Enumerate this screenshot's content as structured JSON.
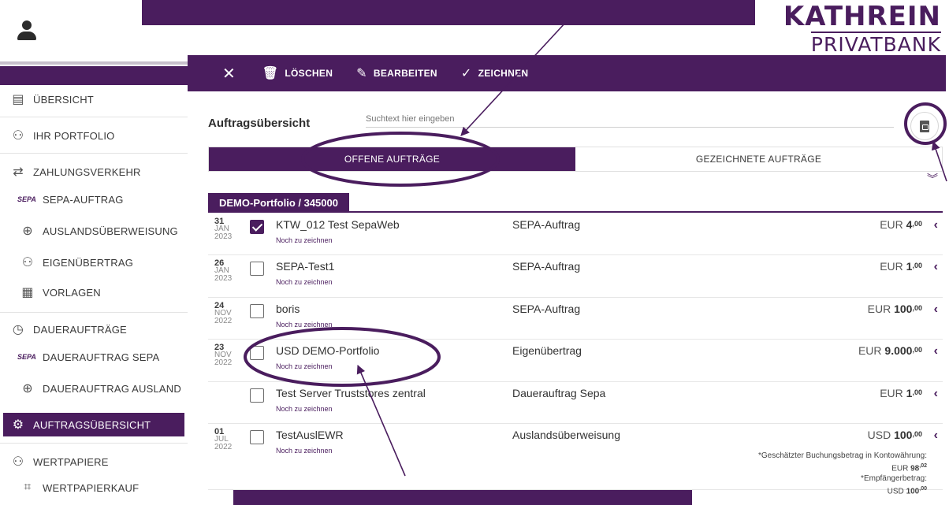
{
  "logo": {
    "line1": "KATHREIN",
    "line2": "PRIVATBANK"
  },
  "sidebar": {
    "items": [
      {
        "label": "ÜBERSICHT",
        "icon": "overview-icon"
      },
      {
        "label": "IHR PORTFOLIO",
        "icon": "portfolio-icon"
      },
      {
        "label": "ZAHLUNGSVERKEHR",
        "icon": "payments-icon"
      },
      {
        "label": "SEPA-AUFTRAG",
        "icon": "sepa-icon",
        "tag": "SEPA"
      },
      {
        "label": "AUSLANDSÜBERWEISUNG",
        "icon": "globe-money-icon"
      },
      {
        "label": "EIGENÜBERTRAG",
        "icon": "own-transfer-icon"
      },
      {
        "label": "VORLAGEN",
        "icon": "templates-icon"
      },
      {
        "label": "DAUERAUFTRÄGE",
        "icon": "standing-order-icon"
      },
      {
        "label": "DAUERAUFTRAG SEPA",
        "icon": "sepa-icon",
        "tag": "SEPA"
      },
      {
        "label": "DAUERAUFTRAG AUSLAND",
        "icon": "globe-money-icon"
      },
      {
        "label": "AUFTRAGSÜBERSICHT",
        "icon": "order-overview-icon",
        "active": true
      },
      {
        "label": "WERTPAPIERE",
        "icon": "securities-icon"
      },
      {
        "label": "WERTPAPIERKAUF",
        "icon": "crop-icon"
      }
    ]
  },
  "toolbar": {
    "close": "✕",
    "delete_label": "LÖSCHEN",
    "edit_label": "BEARBEITEN",
    "sign_label": "ZEICHNEN"
  },
  "main": {
    "title": "Auftragsübersicht",
    "search_placeholder": "Suchtext hier eingeben",
    "tabs": [
      {
        "label": "OFFENE AUFTRÄGE",
        "active": true
      },
      {
        "label": "GEZEICHNETE AUFTRÄGE",
        "active": false
      }
    ],
    "portfolio": "DEMO-Portfolio / 345000",
    "orders": [
      {
        "day": "31",
        "month": "JAN",
        "year": "2023",
        "checked": true,
        "name": "KTW_012 Test SepaWeb",
        "status": "Noch zu zeichnen",
        "type": "SEPA-Auftrag",
        "currency": "EUR",
        "amount": "4",
        "decimals": "00"
      },
      {
        "day": "26",
        "month": "JAN",
        "year": "2023",
        "checked": false,
        "name": "SEPA-Test1",
        "status": "Noch zu zeichnen",
        "type": "SEPA-Auftrag",
        "currency": "EUR",
        "amount": "1",
        "decimals": "00"
      },
      {
        "day": "24",
        "month": "NOV",
        "year": "2022",
        "checked": false,
        "name": "boris",
        "status": "Noch zu zeichnen",
        "type": "SEPA-Auftrag",
        "currency": "EUR",
        "amount": "100",
        "decimals": "00"
      },
      {
        "day": "23",
        "month": "NOV",
        "year": "2022",
        "checked": false,
        "name": "USD DEMO-Portfolio",
        "status": "Noch zu zeichnen",
        "type": "Eigenübertrag",
        "currency": "EUR",
        "amount": "9.000",
        "decimals": "00"
      },
      {
        "day": "",
        "month": "",
        "year": "",
        "checked": false,
        "name": "Test Server Truststores zentral",
        "status": "Noch zu zeichnen",
        "type": "Dauerauftrag Sepa",
        "currency": "EUR",
        "amount": "1",
        "decimals": "00"
      },
      {
        "day": "01",
        "month": "JUL",
        "year": "2022",
        "checked": false,
        "name": "TestAuslEWR",
        "status": "Noch zu zeichnen",
        "type": "Auslandsüberweisung",
        "currency": "USD",
        "amount": "100",
        "decimals": "00"
      }
    ],
    "note": {
      "line1": "*Geschätzter Buchungsbetrag in Kontowährung:",
      "line2_cur": "EUR",
      "line2_amount": "98",
      "line2_dec": "02",
      "line3": "*Empfängerbetrag:",
      "line4_cur": "USD",
      "line4_amount": "100",
      "line4_dec": "00"
    }
  },
  "colors": {
    "brand": "#4a1d5e",
    "annotation": "#4a1d5e"
  }
}
